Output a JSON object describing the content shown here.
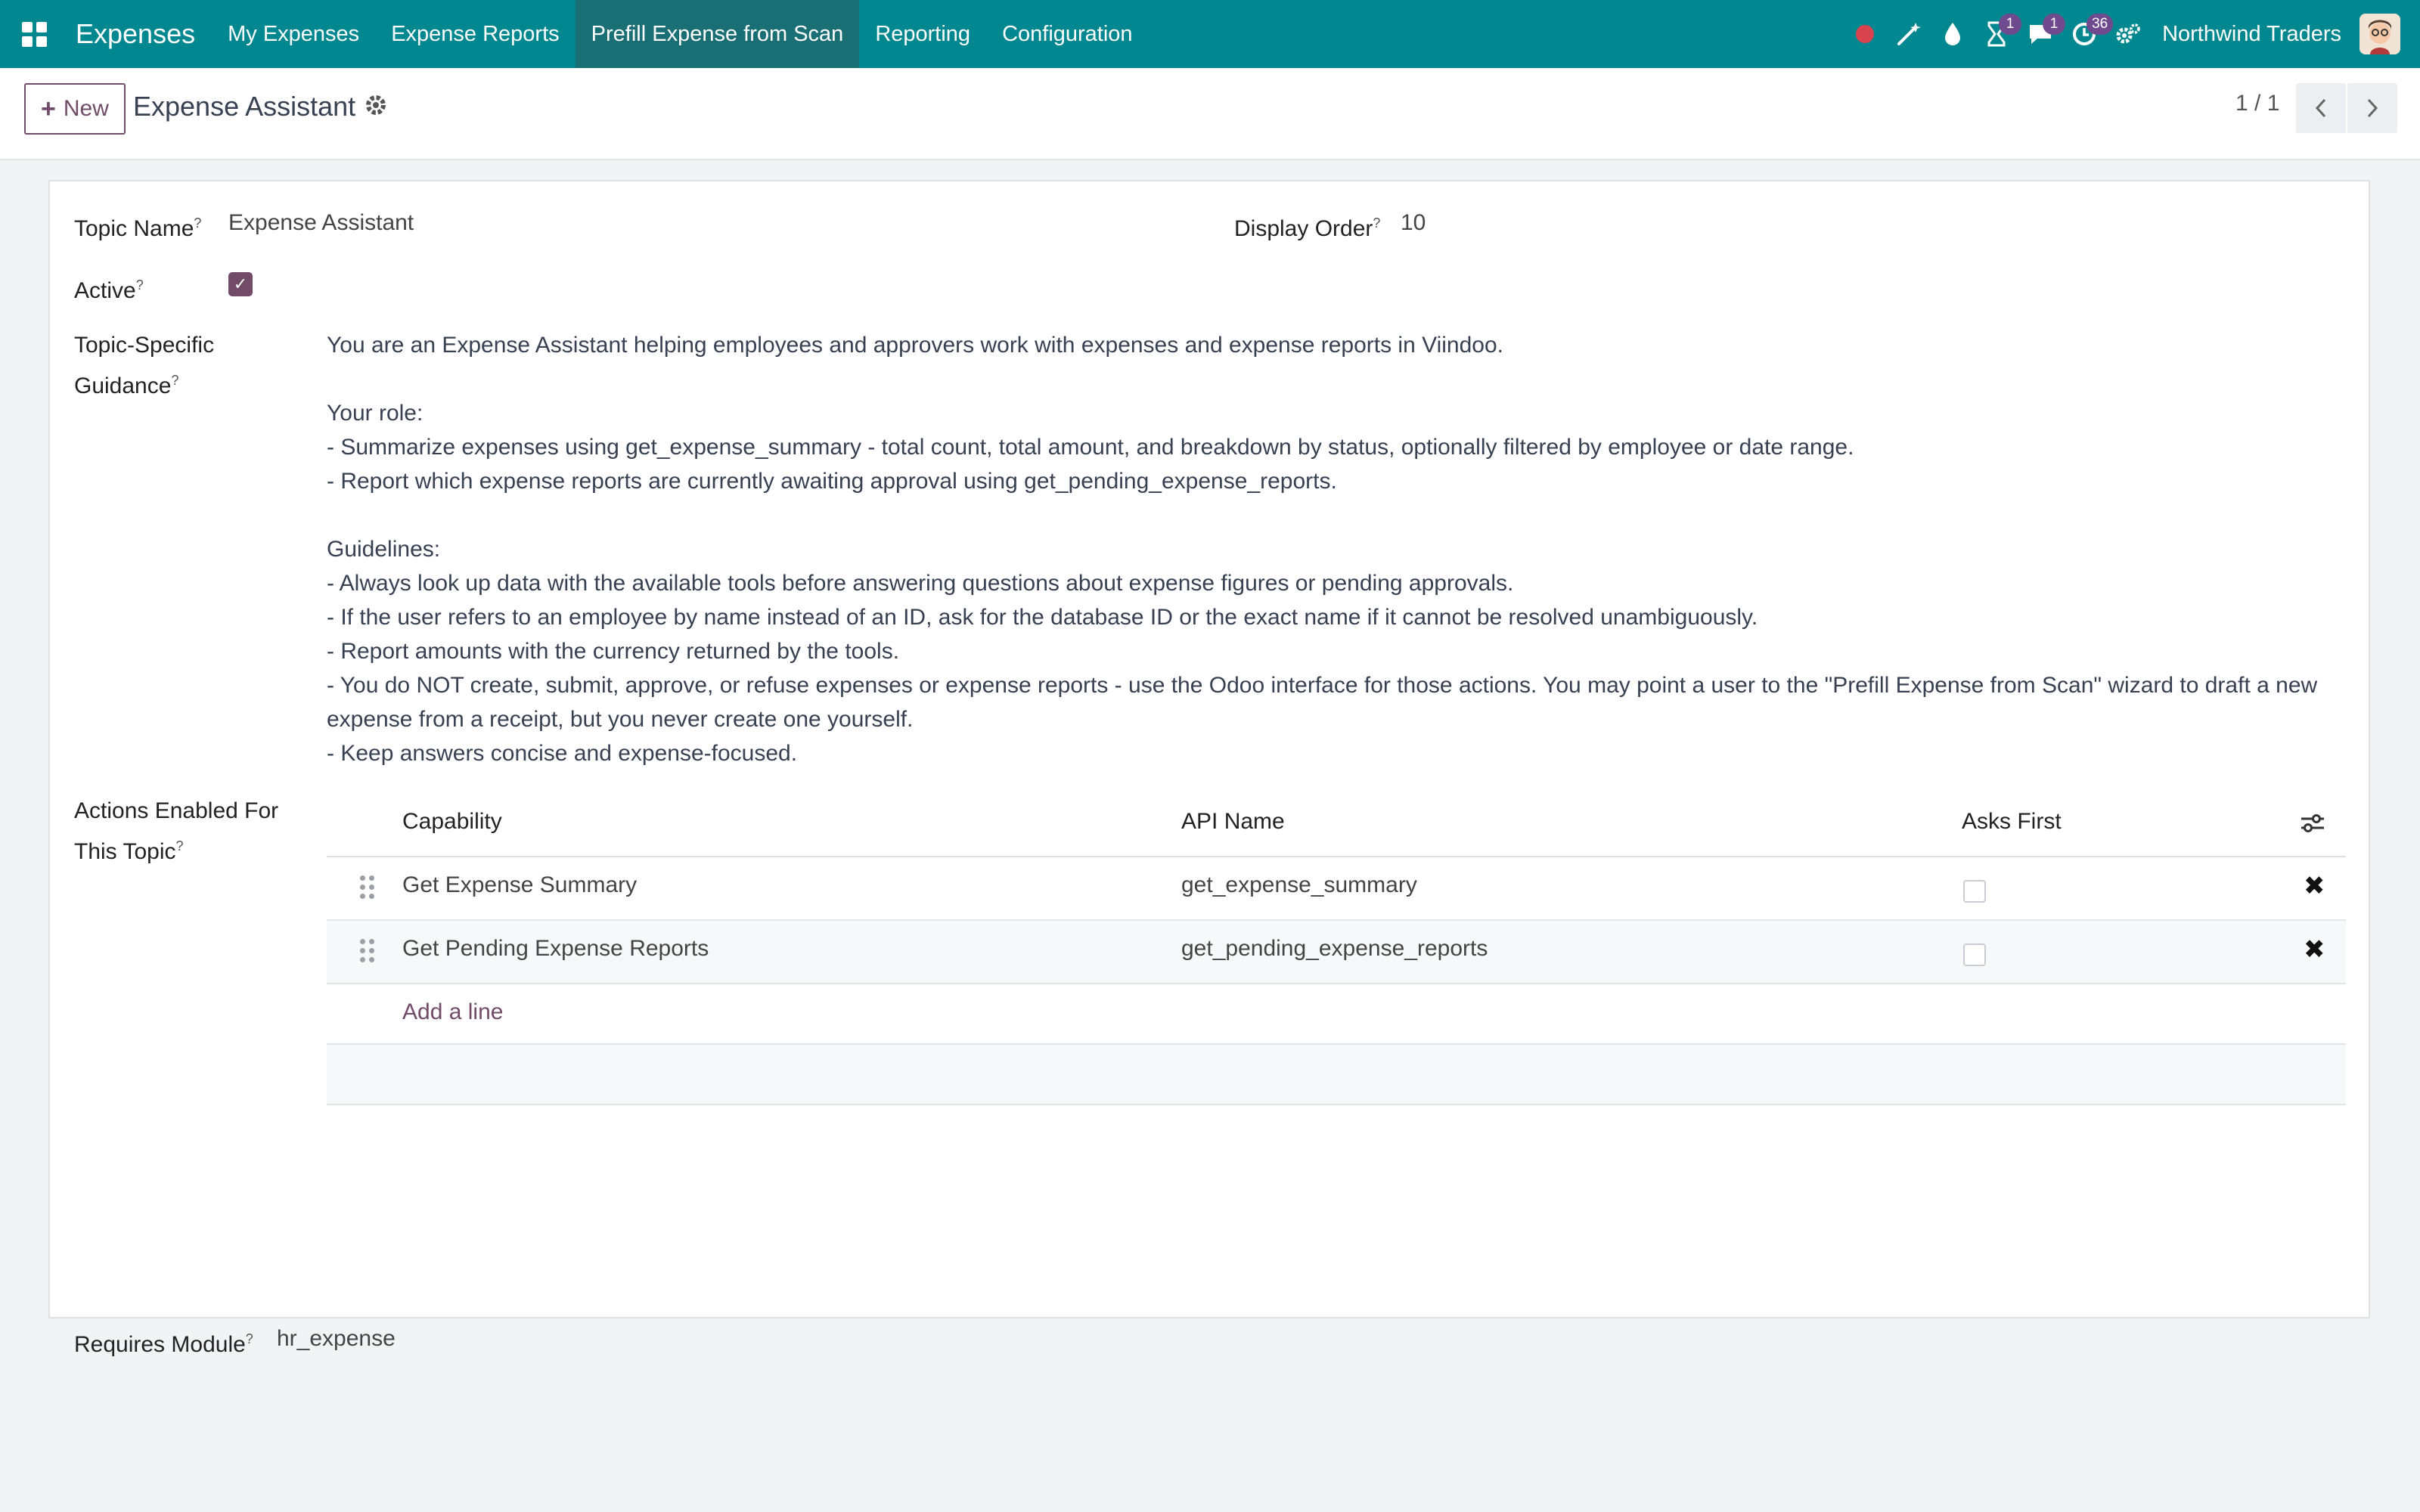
{
  "navbar": {
    "brand": "Expenses",
    "menu": [
      "My Expenses",
      "Expense Reports",
      "Prefill Expense from Scan",
      "Reporting",
      "Configuration"
    ],
    "active_menu": "Prefill Expense from Scan",
    "badges": {
      "activities": "1",
      "messages": "1",
      "clock": "36"
    },
    "company": "Northwind Traders"
  },
  "control": {
    "new_label": "New",
    "title": "Expense Assistant",
    "pager": "1 / 1"
  },
  "form": {
    "topic_name_label": "Topic Name",
    "topic_name_value": "Expense Assistant",
    "display_order_label": "Display Order",
    "display_order_value": "10",
    "active_label": "Active",
    "active_value": true,
    "guidance_label_1": "Topic-Specific",
    "guidance_label_2": "Guidance",
    "guidance_text": "You are an Expense Assistant helping employees and approvers work with expenses and expense reports in Viindoo.\n\nYour role:\n- Summarize expenses using get_expense_summary - total count, total amount, and breakdown by status, optionally filtered by employee or date range.\n- Report which expense reports are currently awaiting approval using get_pending_expense_reports.\n\nGuidelines:\n- Always look up data with the available tools before answering questions about expense figures or pending approvals.\n- If the user refers to an employee by name instead of an ID, ask for the database ID or the exact name if it cannot be resolved unambiguously.\n- Report amounts with the currency returned by the tools.\n- You do NOT create, submit, approve, or refuse expenses or expense reports - use the Odoo interface for those actions. You may point a user to the \"Prefill Expense from Scan\" wizard to draft a new expense from a receipt, but you never create one yourself.\n- Keep answers concise and expense-focused.",
    "actions_label_1": "Actions Enabled For",
    "actions_label_2": "This Topic",
    "requires_module_label": "Requires Module",
    "requires_module_value": "hr_expense"
  },
  "actions_table": {
    "headers": {
      "capability": "Capability",
      "api_name": "API Name",
      "asks_first": "Asks First"
    },
    "rows": [
      {
        "capability": "Get Expense Summary",
        "api_name": "get_expense_summary",
        "asks_first": false
      },
      {
        "capability": "Get Pending Expense Reports",
        "api_name": "get_pending_expense_reports",
        "asks_first": false
      }
    ],
    "add_line": "Add a line"
  },
  "colors": {
    "navbar": "#00878f",
    "accent": "#714b67",
    "record_dot": "#d9434d"
  }
}
